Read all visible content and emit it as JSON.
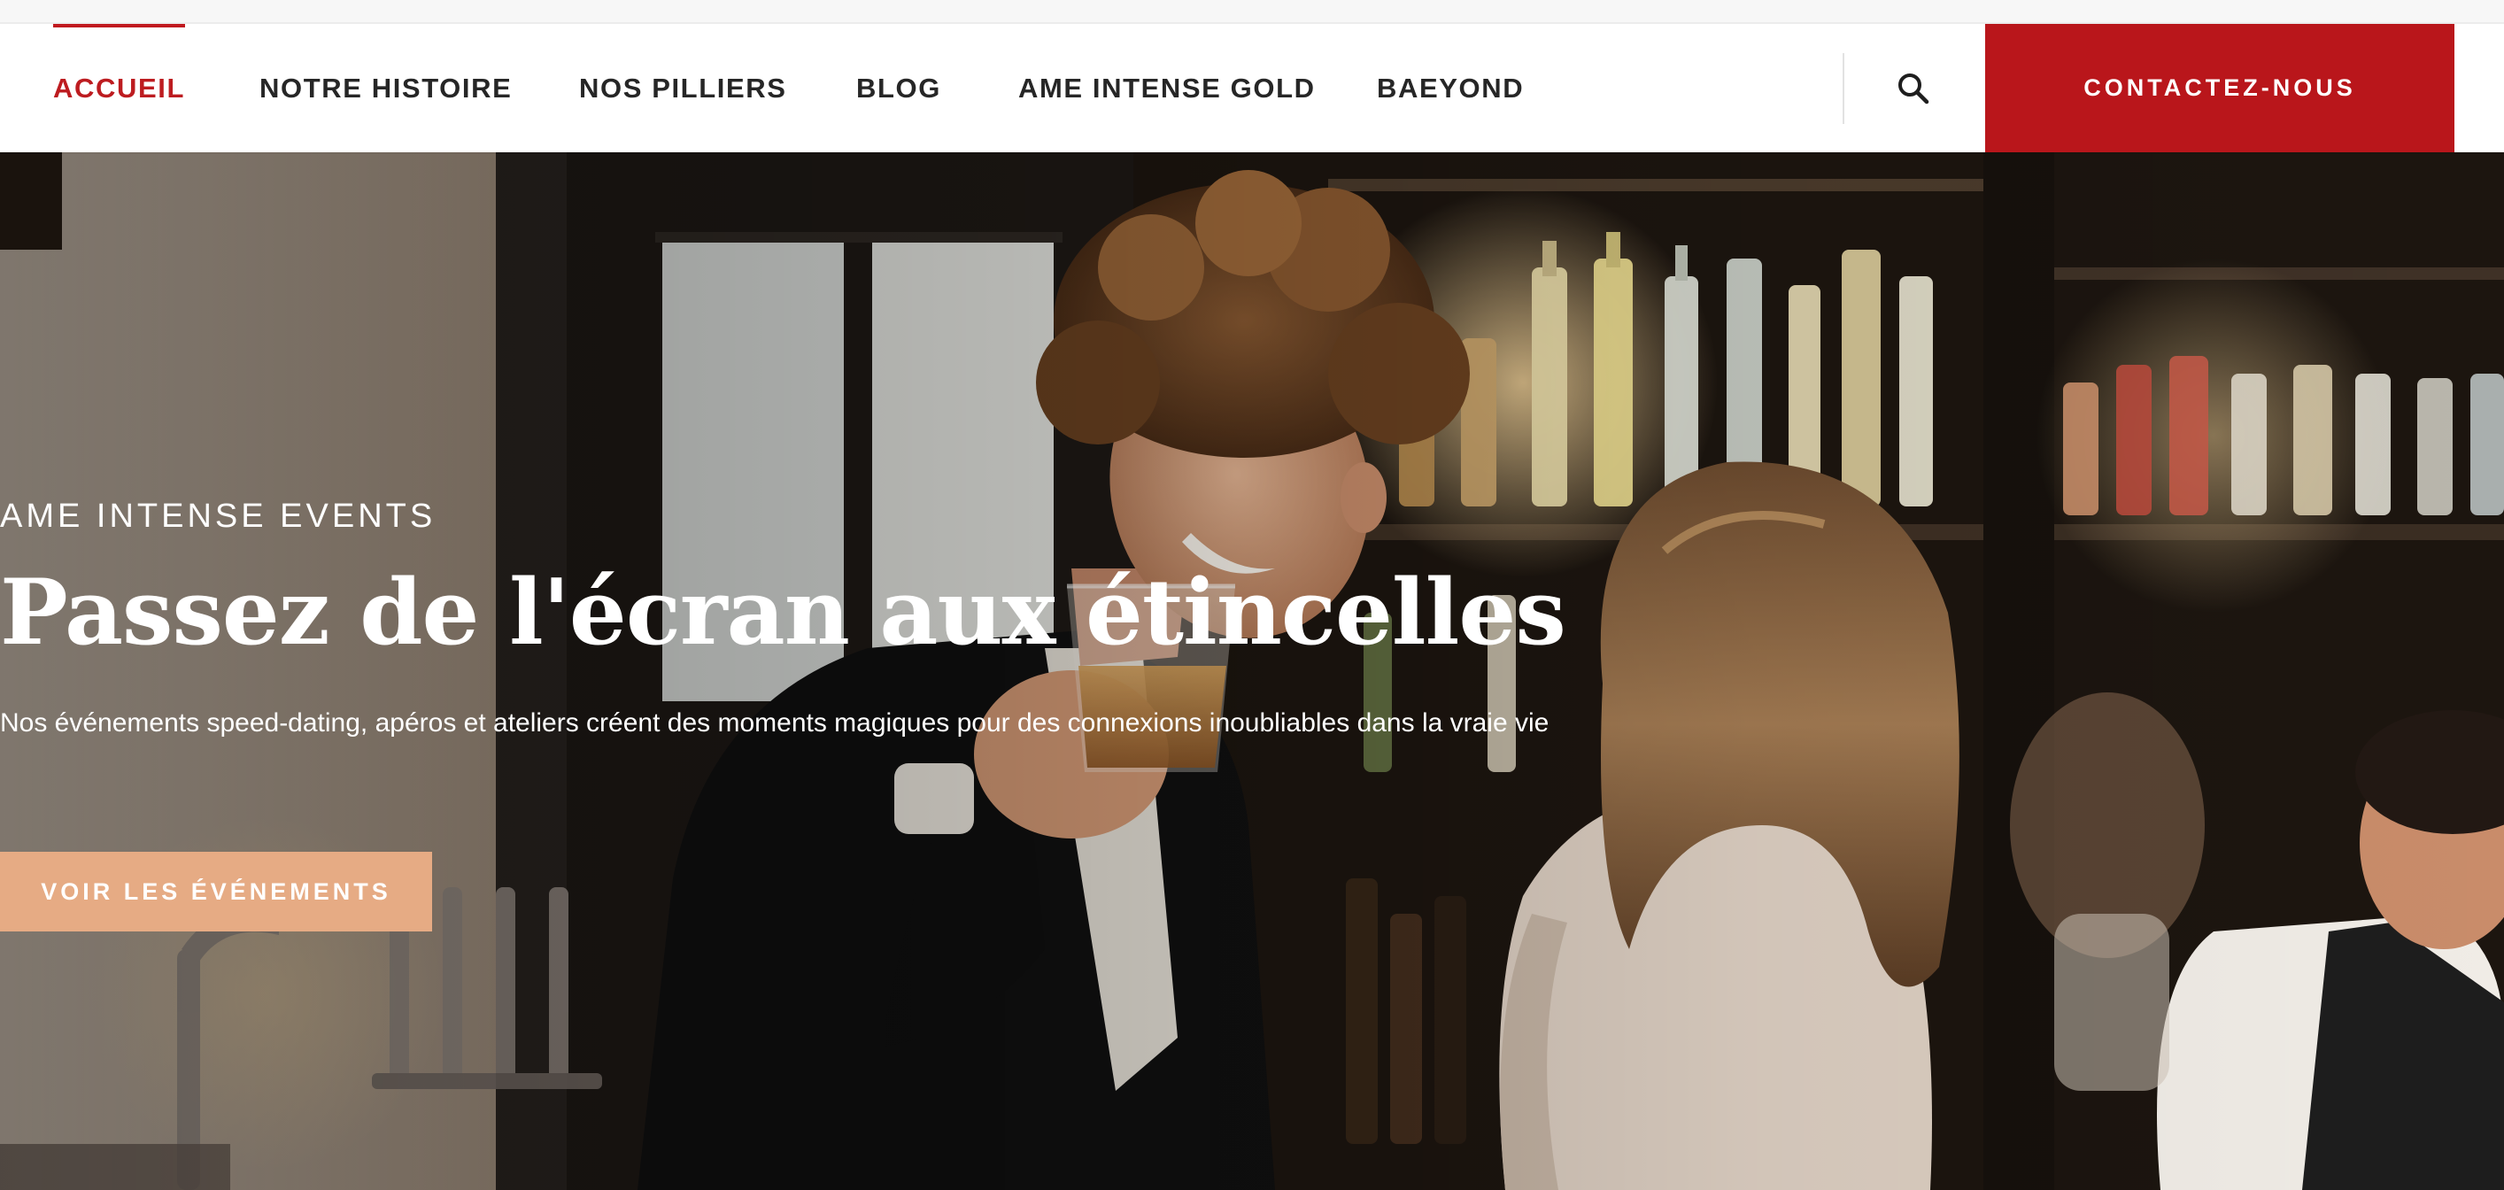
{
  "header": {
    "nav": [
      {
        "label": "ACCUEIL",
        "active": true
      },
      {
        "label": "NOTRE HISTOIRE",
        "active": false
      },
      {
        "label": "NOS PILLIERS",
        "active": false
      },
      {
        "label": "BLOG",
        "active": false
      },
      {
        "label": "AME INTENSE GOLD",
        "active": false
      },
      {
        "label": "BAEYOND",
        "active": false
      }
    ],
    "search_icon": "search-icon",
    "contact_label": "CONTACTEZ-NOUS"
  },
  "hero": {
    "kicker": "AME INTENSE EVENTS",
    "title": "Passez de l'écran aux étincelles",
    "subtitle": "Nos événements speed-dating, apéros et ateliers créent des moments magiques pour des connexions inoubliables dans la vraie vie",
    "cta_label": "VOIR LES ÉVÉNEMENTS"
  },
  "colors": {
    "accent_red": "#b9161b",
    "active_nav": "#bd1c20",
    "cta_peach": "#e6ab84",
    "nav_text": "#262626"
  }
}
